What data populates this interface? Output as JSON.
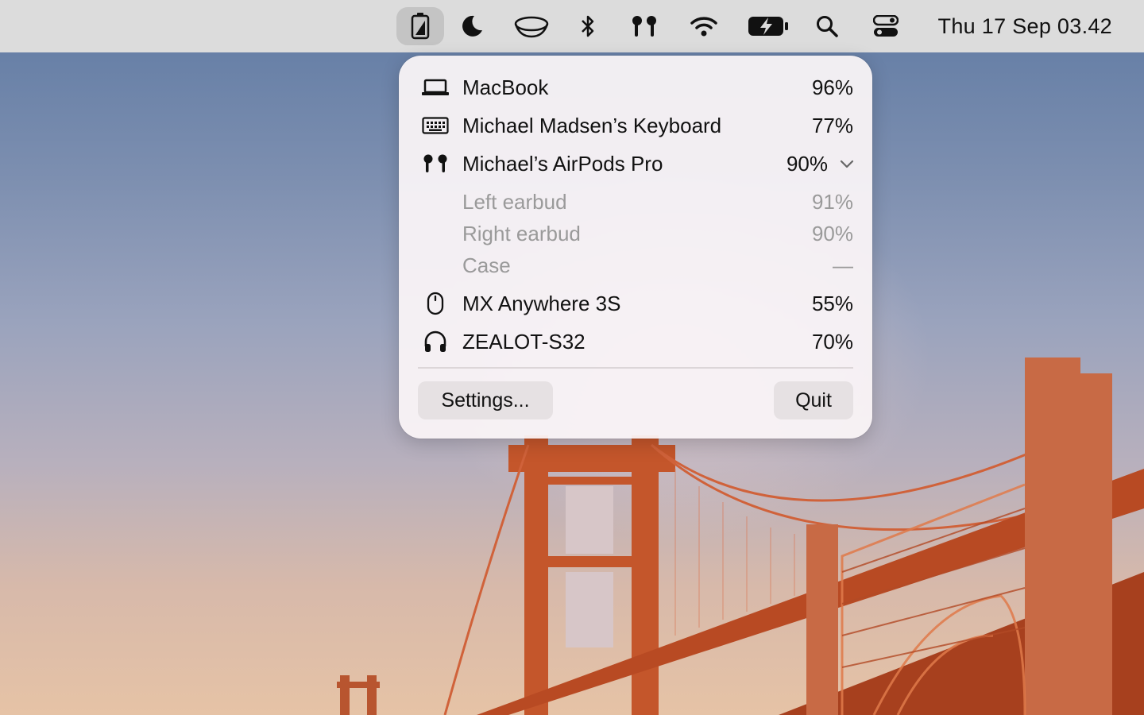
{
  "menubar": {
    "icons": [
      {
        "name": "battery-app-icon",
        "active": true
      },
      {
        "name": "moon-icon"
      },
      {
        "name": "bowl-icon"
      },
      {
        "name": "bluetooth-icon"
      },
      {
        "name": "airpods-icon"
      },
      {
        "name": "wifi-icon"
      },
      {
        "name": "battery-charging-icon"
      },
      {
        "name": "search-icon"
      },
      {
        "name": "control-center-icon"
      }
    ],
    "clock": "Thu 17 Sep  03.42"
  },
  "popover": {
    "devices": [
      {
        "icon": "laptop-icon",
        "label": "MacBook",
        "percent": "96%"
      },
      {
        "icon": "keyboard-icon",
        "label": "Michael Madsen’s Keyboard",
        "percent": "77%"
      },
      {
        "icon": "airpods-icon",
        "label": "Michael’s AirPods Pro",
        "percent": "90%"
      },
      {
        "icon": "mouse-icon",
        "label": "MX Anywhere 3S",
        "percent": "55%"
      },
      {
        "icon": "headphones-icon",
        "label": "ZEALOT-S32",
        "percent": "70%"
      }
    ],
    "airpods_details": [
      {
        "label": "Left earbud",
        "percent": "91%"
      },
      {
        "label": "Right earbud",
        "percent": "90%"
      },
      {
        "label": "Case",
        "percent": "—"
      }
    ],
    "settings_label": "Settings...",
    "quit_label": "Quit"
  }
}
